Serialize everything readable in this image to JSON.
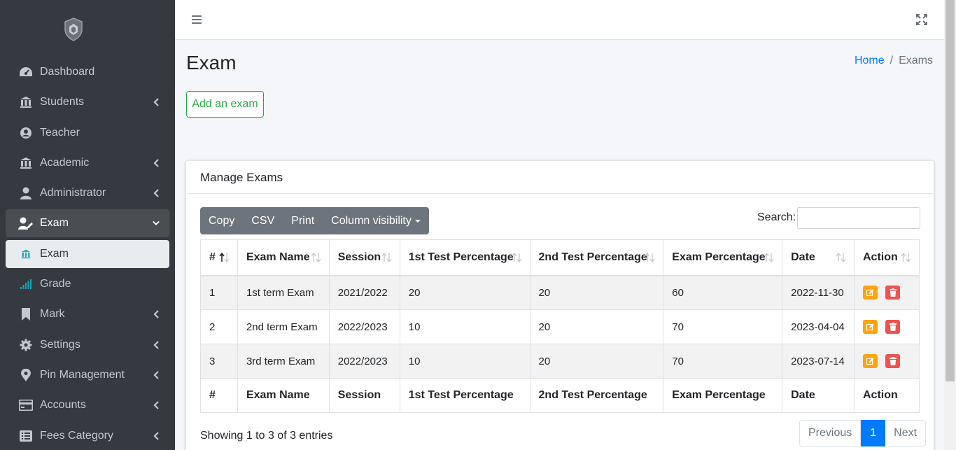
{
  "sidebar": {
    "items": [
      {
        "label": "Dashboard",
        "icon": "dashboard-icon",
        "chevron": false
      },
      {
        "label": "Students",
        "icon": "bank-icon",
        "chevron": true
      },
      {
        "label": "Teacher",
        "icon": "user-circle-icon",
        "chevron": false
      },
      {
        "label": "Academic",
        "icon": "bank-icon",
        "chevron": true
      },
      {
        "label": "Administrator",
        "icon": "user-icon",
        "chevron": true
      },
      {
        "label": "Exam",
        "icon": "user-edit-icon",
        "chevron": true,
        "state": "open"
      },
      {
        "label": "Exam",
        "icon": "bank-icon",
        "chevron": false,
        "state": "active",
        "sub": true
      },
      {
        "label": "Grade",
        "icon": "signal-icon",
        "chevron": false,
        "sub": true
      },
      {
        "label": "Mark",
        "icon": "bookmark-icon",
        "chevron": true
      },
      {
        "label": "Settings",
        "icon": "gear-icon",
        "chevron": true
      },
      {
        "label": "Pin Management",
        "icon": "map-pin-icon",
        "chevron": true
      },
      {
        "label": "Accounts",
        "icon": "credit-card-icon",
        "chevron": true
      },
      {
        "label": "Fees Category",
        "icon": "list-icon",
        "chevron": true
      }
    ]
  },
  "page": {
    "title": "Exam",
    "breadcrumb": {
      "home": "Home",
      "sep": "/",
      "current": "Exams"
    },
    "add_button": "Add an exam"
  },
  "card": {
    "title": "Manage Exams",
    "buttons": {
      "copy": "Copy",
      "csv": "CSV",
      "print": "Print",
      "colvis": "Column visibility"
    },
    "search_label": "Search:",
    "search_value": "",
    "columns": [
      "#",
      "Exam Name",
      "Session",
      "1st Test Percentage",
      "2nd Test Percentage",
      "Exam Percentage",
      "Date",
      "Action"
    ],
    "rows": [
      [
        "1",
        "1st term Exam",
        "2021/2022",
        "20",
        "20",
        "60",
        "2022-11-30"
      ],
      [
        "2",
        "2nd term Exam",
        "2022/2023",
        "10",
        "20",
        "70",
        "2023-04-04"
      ],
      [
        "3",
        "3rd term Exam",
        "2022/2023",
        "10",
        "20",
        "70",
        "2023-07-14"
      ]
    ],
    "info": "Showing 1 to 3 of 3 entries",
    "pager": {
      "prev": "Previous",
      "current": "1",
      "next": "Next"
    }
  },
  "colors": {
    "sidebar": "#343a40",
    "primary": "#007bff",
    "success": "#28a745",
    "edit": "#ffa30f",
    "delete": "#f0524f"
  }
}
